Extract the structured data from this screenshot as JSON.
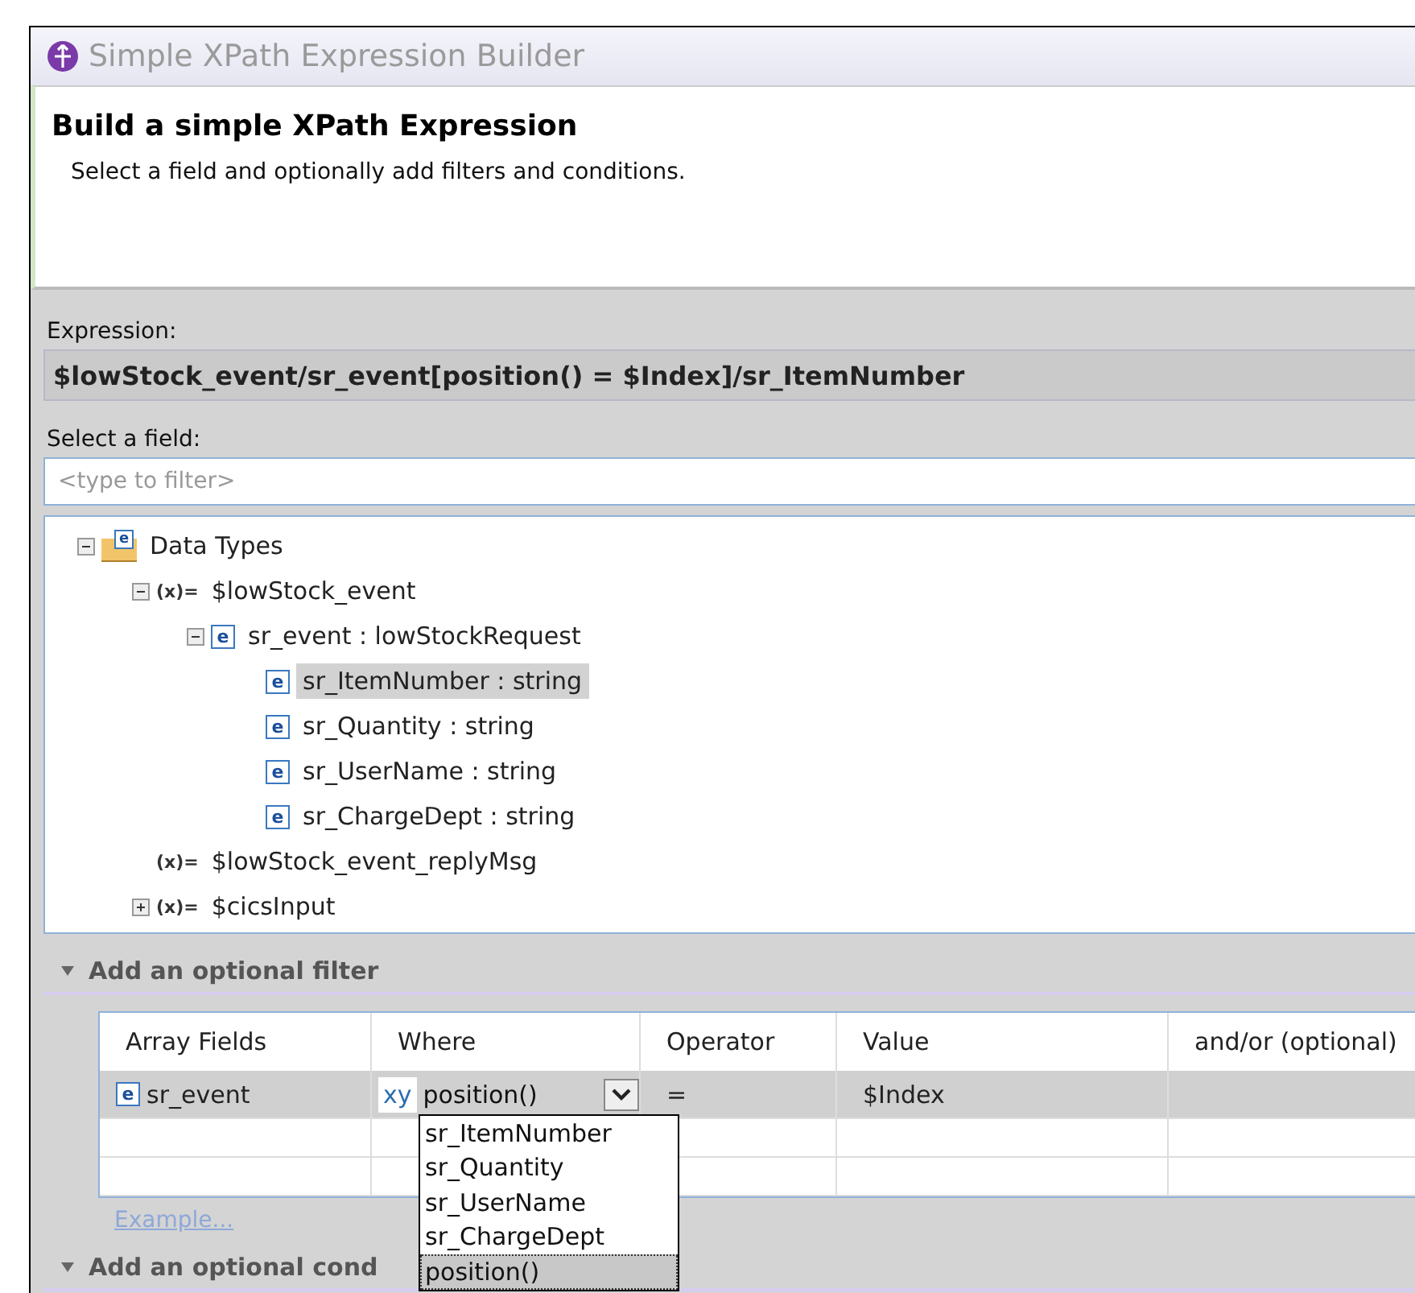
{
  "window": {
    "title": "Simple XPath Expression Builder"
  },
  "header": {
    "title": "Build a simple XPath Expression",
    "description": "Select a field and optionally add filters and conditions."
  },
  "expression": {
    "label": "Expression:",
    "value": "$lowStock_event/sr_event[position() = $Index]/sr_ItemNumber"
  },
  "field_picker": {
    "label": "Select a field:",
    "placeholder": "<type to filter>"
  },
  "tree": [
    {
      "label": "Data Types",
      "kind": "folder",
      "icon_text": "e",
      "expanded": true,
      "selected": false,
      "children": [
        {
          "label": "$lowStock_event",
          "kind": "variable",
          "icon_text": "(x)=",
          "expanded": true,
          "selected": false,
          "children": [
            {
              "label": "sr_event : lowStockRequest",
              "kind": "element",
              "icon_text": "e",
              "expanded": true,
              "selected": false,
              "children": [
                {
                  "label": "sr_ItemNumber : string",
                  "kind": "element",
                  "icon_text": "e",
                  "selected": true
                },
                {
                  "label": "sr_Quantity : string",
                  "kind": "element",
                  "icon_text": "e",
                  "selected": false
                },
                {
                  "label": "sr_UserName : string",
                  "kind": "element",
                  "icon_text": "e",
                  "selected": false
                },
                {
                  "label": "sr_ChargeDept : string",
                  "kind": "element",
                  "icon_text": "e",
                  "selected": false
                }
              ]
            }
          ]
        },
        {
          "label": "$lowStock_event_replyMsg",
          "kind": "variable",
          "icon_text": "(x)=",
          "selected": false
        },
        {
          "label": "$cicsInput",
          "kind": "variable",
          "icon_text": "(x)=",
          "expanded": false,
          "selected": false
        }
      ]
    }
  ],
  "filter_section": {
    "title": "Add an optional filter",
    "expanded": true,
    "columns": [
      "Array Fields",
      "Where",
      "Operator",
      "Value",
      "and/or (optional)"
    ],
    "rows": [
      {
        "icon_text": "e",
        "array_field": "sr_event",
        "where_icon_text": "xy",
        "where": "position()",
        "operator": "=",
        "value": "$Index"
      },
      {},
      {}
    ],
    "example_link": "Example...",
    "where_dropdown": {
      "options": [
        {
          "label": "sr_ItemNumber",
          "selected": false
        },
        {
          "label": "sr_Quantity",
          "selected": false
        },
        {
          "label": "sr_UserName",
          "selected": false
        },
        {
          "label": "sr_ChargeDept",
          "selected": false
        },
        {
          "label": "position()",
          "selected": true
        }
      ]
    }
  },
  "condition_section": {
    "title": "Add an optional cond",
    "expanded": true
  }
}
